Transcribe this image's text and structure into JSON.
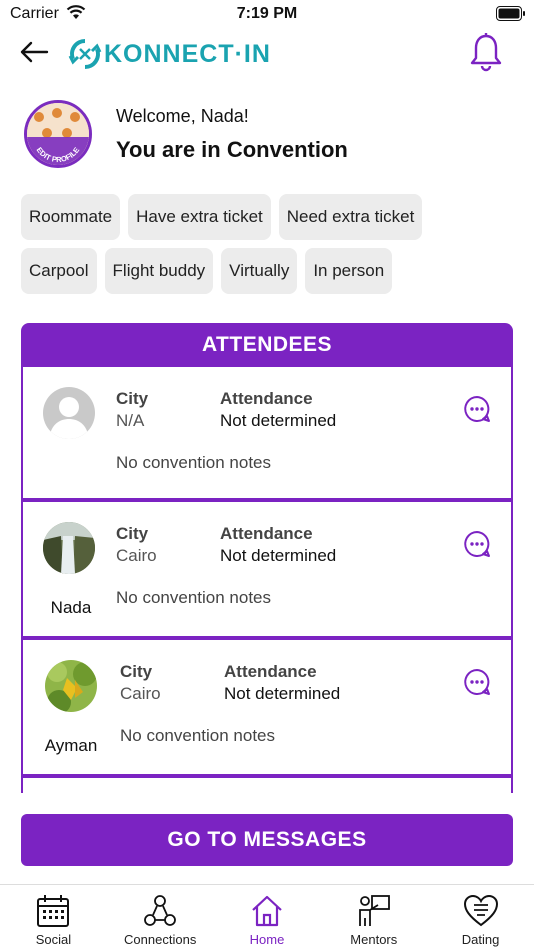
{
  "status": {
    "carrier": "Carrier",
    "time": "7:19 PM"
  },
  "nav": {
    "logo_text": "KONNECT·IN"
  },
  "profile": {
    "welcome": "Welcome, Nada!",
    "status_line": "You are in Convention",
    "avatar_badge": "EDIT PROFILE"
  },
  "chips": {
    "row1": [
      "Roommate",
      "Have extra ticket",
      "Need extra ticket"
    ],
    "row2": [
      "Carpool",
      "Flight buddy",
      "Virtually",
      "In person"
    ]
  },
  "attendees": {
    "header": "ATTENDEES",
    "city_label": "City",
    "attendance_label": "Attendance",
    "items": [
      {
        "name": "",
        "city": "N/A",
        "attendance": "Not determined",
        "notes": "No convention notes",
        "avatar": "default-person"
      },
      {
        "name": "Nada",
        "city": "Cairo",
        "attendance": "Not determined",
        "notes": "No convention notes",
        "avatar": "waterfall-photo"
      },
      {
        "name": "Ayman",
        "city": "Cairo",
        "attendance": "Not determined",
        "notes": "No convention notes",
        "avatar": "fruit-tree-photo"
      }
    ]
  },
  "go_messages": "GO TO MESSAGES",
  "tabs": [
    {
      "label": "Social",
      "icon": "calendar-icon"
    },
    {
      "label": "Connections",
      "icon": "connections-icon"
    },
    {
      "label": "Home",
      "icon": "home-icon",
      "active": true
    },
    {
      "label": "Mentors",
      "icon": "mentor-icon"
    },
    {
      "label": "Dating",
      "icon": "heart-icon"
    }
  ],
  "colors": {
    "accent": "#7b23c2",
    "logo": "#1aa3b0",
    "chip_bg": "#ececec"
  }
}
